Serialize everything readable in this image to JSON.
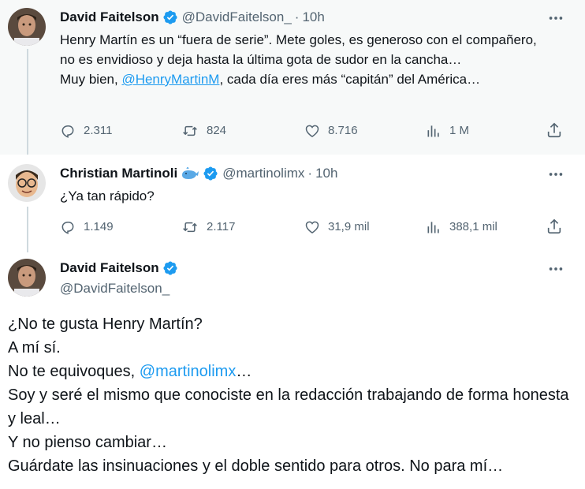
{
  "tweets": [
    {
      "name": "David Faitelson",
      "handle": "@DavidFaitelson_",
      "time": "10h",
      "text_lines": [
        "Henry Martín es un “fuera de serie”. Mete goles, es generoso con el compañero, no es envidioso y deja hasta la última gota de sudor en la cancha…"
      ],
      "text_prefix": "Muy bien, ",
      "text_mention": "@HenryMartinM",
      "text_suffix": ", cada día eres más “capitán” del América…",
      "replies": "2.311",
      "retweets": "824",
      "likes": "8.716",
      "views": "1 M"
    },
    {
      "name": "Christian Martinoli",
      "handle": "@martinolimx",
      "time": "10h",
      "text": "¿Ya tan rápido?",
      "replies": "1.149",
      "retweets": "2.117",
      "likes": "31,9 mil",
      "views": "388,1 mil"
    }
  ],
  "main_tweet": {
    "name": "David Faitelson",
    "handle": "@DavidFaitelson_",
    "line1": "¿No te gusta Henry Martín?",
    "line2": "A mí sí.",
    "line3_prefix": "No te equivoques, ",
    "line3_mention": "@martinolimx",
    "line3_suffix": "…",
    "line4": "Soy y seré el mismo que conociste en la redacción trabajando de forma honesta y leal…",
    "line5": "Y no pienso cambiar…",
    "line6": "Guárdate las insinuaciones y el doble sentido para otros. No para mí…"
  },
  "colors": {
    "accent": "#1d9bf0",
    "muted": "#536471",
    "highlight_bg": "#f7f9f9",
    "thread_line": "#cfd9de"
  },
  "icons": [
    "verified-badge-icon",
    "whale-emoji-icon",
    "more-icon",
    "reply-icon",
    "retweet-icon",
    "like-icon",
    "views-icon",
    "share-icon"
  ]
}
